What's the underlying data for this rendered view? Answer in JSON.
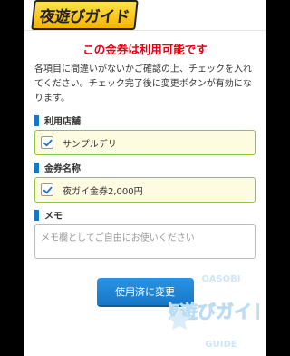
{
  "header": {
    "logo_text": "夜遊びガイド"
  },
  "notice": {
    "title": "この金券は利用可能です",
    "description": "各項目に間違いがないかご確認の上、チェックを入れてください。チェック完了後に変更ボタンが有効になります。"
  },
  "sections": {
    "store": {
      "label": "利用店舗",
      "value": "サンプルデリ",
      "checked": true
    },
    "coupon": {
      "label": "金券名称",
      "value": "夜ガイ金券2,000円",
      "checked": true
    },
    "memo": {
      "label": "メモ",
      "placeholder": "メモ欄としてご自由にお使いください",
      "value": ""
    }
  },
  "submit_label": "使用済に変更",
  "watermark": {
    "top_text": "OASOBI",
    "main_text": "夜遊びガイド",
    "bottom_text": "GUIDE"
  },
  "colors": {
    "accent": "#1677c7",
    "alert": "#e60012",
    "check_border": "#8cc63f",
    "check_bg": "#fdfbe0"
  }
}
